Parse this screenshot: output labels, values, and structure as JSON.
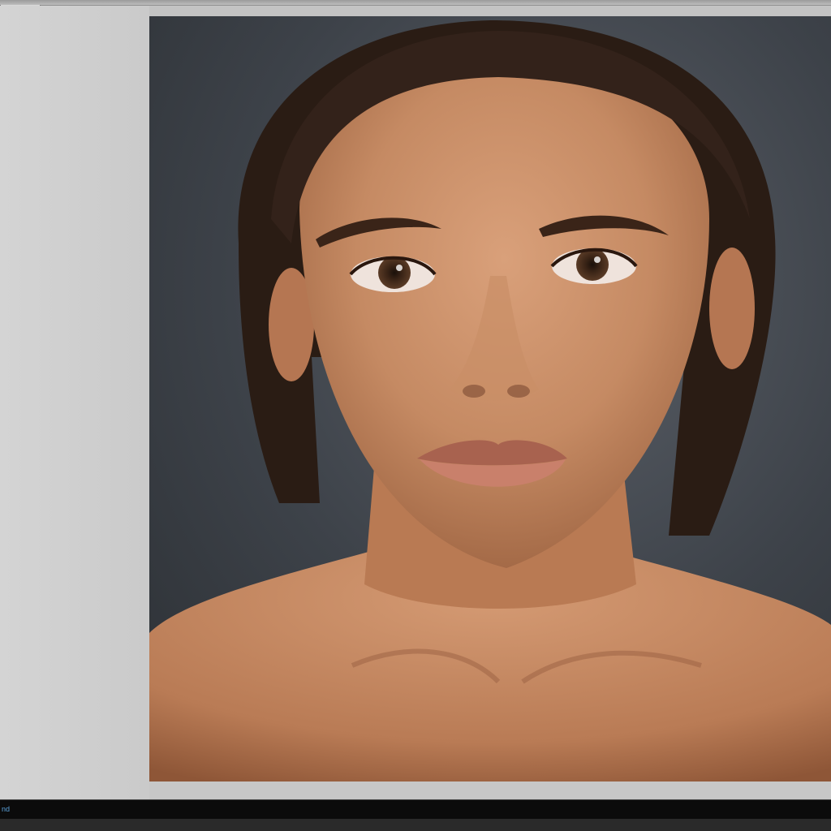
{
  "window": {
    "tab_label": "–––––"
  },
  "canvas": {
    "image_description_icon": "portrait-photo"
  },
  "statusbar": {
    "text": "nd"
  },
  "colors": {
    "background_gray": "#cfcfcf",
    "photo_backdrop": "#3d4249",
    "statusbar": "#0b0b0b",
    "status_text": "#5aa0d8"
  }
}
